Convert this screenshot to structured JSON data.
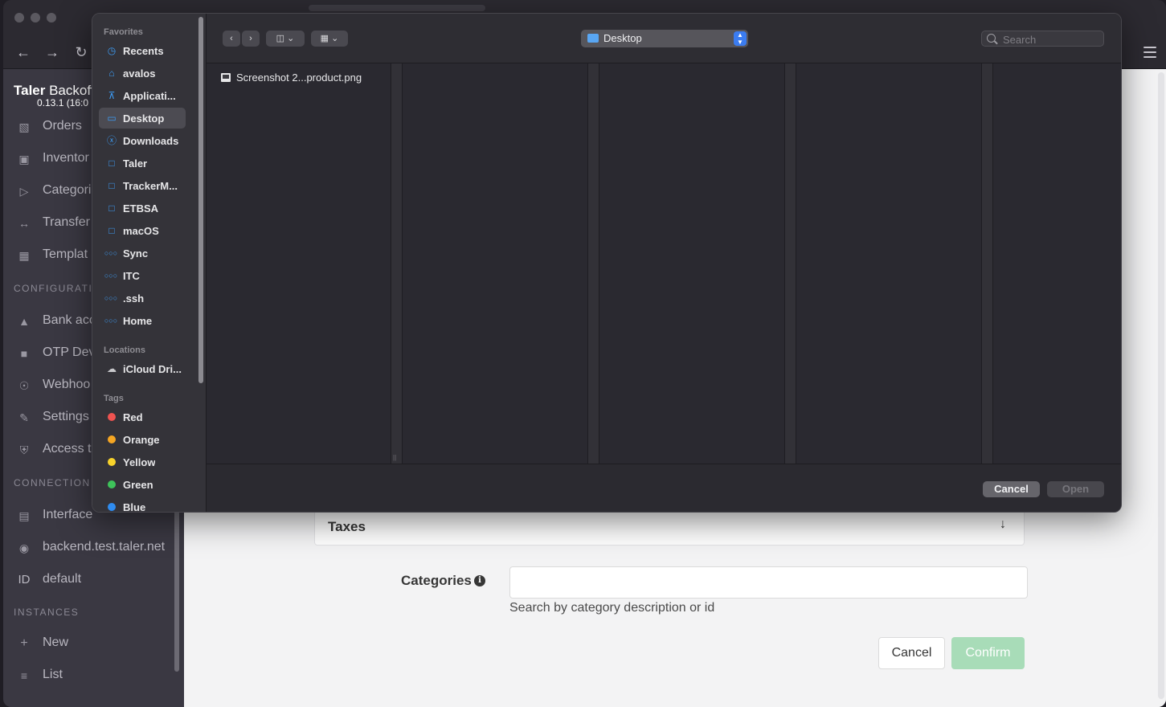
{
  "app": {
    "brand_name": "Taler Backoff",
    "version": "0.13.1 (16:0",
    "nav": [
      {
        "label": "Orders",
        "icon": "orders-icon"
      },
      {
        "label": "Inventor",
        "icon": "inventory-icon"
      },
      {
        "label": "Categori",
        "icon": "tag-icon"
      },
      {
        "label": "Transfer",
        "icon": "transfer-icon"
      },
      {
        "label": "Templat",
        "icon": "qr-icon"
      }
    ],
    "config_section": "CONFIGURATI",
    "config_nav": [
      {
        "label": "Bank acc",
        "icon": "bank-icon"
      },
      {
        "label": "OTP Dev",
        "icon": "lock-icon"
      },
      {
        "label": "Webhoo",
        "icon": "webhook-icon"
      },
      {
        "label": "Settings",
        "icon": "edit-icon"
      },
      {
        "label": "Access t",
        "icon": "shield-icon"
      }
    ],
    "connection_section": "CONNECTION",
    "connection_nav": [
      {
        "label": "Interface",
        "icon": "table-icon"
      },
      {
        "label": "backend.test.taler.net",
        "icon": "globe-icon"
      },
      {
        "label": "default",
        "icon": "id-icon",
        "icon_text": "ID"
      }
    ],
    "instances_section": "INSTANCES",
    "instances_nav": [
      {
        "label": "New",
        "icon": "plus-icon"
      },
      {
        "label": "List",
        "icon": "list-icon"
      }
    ]
  },
  "form": {
    "taxes_label": "Taxes",
    "categories_label": "Categories",
    "categories_help": "Search by category description or id",
    "cancel_label": "Cancel",
    "confirm_label": "Confirm"
  },
  "dialog": {
    "favorites_head": "Favorites",
    "favorites": [
      {
        "label": "Recents",
        "icon": "clock-icon"
      },
      {
        "label": "avalos",
        "icon": "home-icon"
      },
      {
        "label": "Applicati...",
        "icon": "applications-icon"
      },
      {
        "label": "Desktop",
        "icon": "desktop-icon",
        "selected": true
      },
      {
        "label": "Downloads",
        "icon": "download-icon"
      },
      {
        "label": "Taler",
        "icon": "folder-icon"
      },
      {
        "label": "TrackerM...",
        "icon": "folder-icon"
      },
      {
        "label": "ETBSA",
        "icon": "folder-icon"
      },
      {
        "label": "macOS",
        "icon": "folder-icon"
      },
      {
        "label": "Sync",
        "icon": "nextcloud-icon"
      },
      {
        "label": "ITC",
        "icon": "nextcloud-icon"
      },
      {
        "label": ".ssh",
        "icon": "nextcloud-icon"
      },
      {
        "label": "Home",
        "icon": "nextcloud-icon"
      }
    ],
    "locations_head": "Locations",
    "locations": [
      {
        "label": "iCloud Dri...",
        "icon": "cloud-icon"
      }
    ],
    "tags_head": "Tags",
    "tags": [
      {
        "label": "Red",
        "color": "#ef5350"
      },
      {
        "label": "Orange",
        "color": "#f5a623"
      },
      {
        "label": "Yellow",
        "color": "#f8d32b"
      },
      {
        "label": "Green",
        "color": "#3ec35a"
      },
      {
        "label": "Blue",
        "color": "#2f8cf0"
      }
    ],
    "location": "Desktop",
    "search_placeholder": "Search",
    "file_name": "Screenshot 2...product.png",
    "cancel_label": "Cancel",
    "open_label": "Open"
  }
}
